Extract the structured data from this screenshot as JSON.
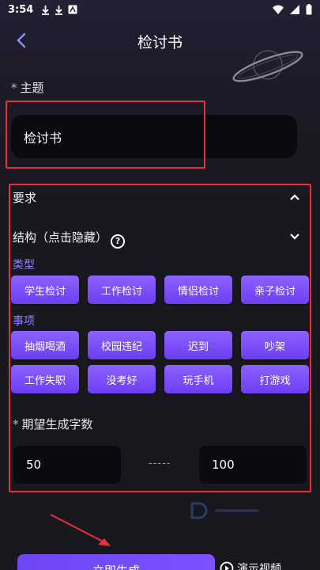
{
  "status_bar": {
    "time": "3:54"
  },
  "header": {
    "title": "检讨书",
    "back_icon": "chevron-left-icon"
  },
  "topic": {
    "required_mark": "*",
    "label": "主题",
    "value": "检讨书"
  },
  "requirements": {
    "label": "要求"
  },
  "structure": {
    "label": "结构（点击隐藏）",
    "help_icon": "?"
  },
  "types": {
    "label": "类型",
    "items": [
      "学生检讨",
      "工作检讨",
      "情侣检讨",
      "亲子检讨"
    ]
  },
  "matters": {
    "label": "事项",
    "items": [
      "抽烟喝酒",
      "校园违纪",
      "迟到",
      "吵架",
      "工作失职",
      "没考好",
      "玩手机",
      "打游戏"
    ]
  },
  "word_count": {
    "required_mark": "*",
    "label": "期望生成字数",
    "min": "50",
    "separator": "-----",
    "max": "100"
  },
  "footer": {
    "generate_label": "立即生成",
    "demo_label": "演示视频"
  },
  "colors": {
    "accent": "#7a52ff",
    "category_text": "#8f82ff",
    "highlight_box": "#e8303a",
    "field_bg": "#0b0b0f"
  }
}
